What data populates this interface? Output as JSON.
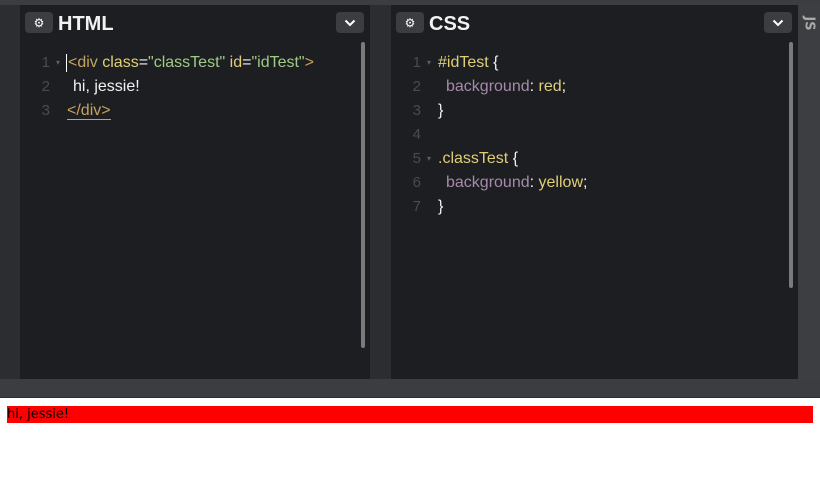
{
  "html_panel": {
    "title": "HTML",
    "gear_icon": "gear-icon",
    "chevron_icon": "chevron-down-icon",
    "line_numbers": [
      "1",
      "2",
      "3"
    ],
    "lines": [
      {
        "open": "<div",
        "attr1": "class",
        "eq1": "=",
        "val1": "\"classTest\"",
        "attr2": "id",
        "eq2": "=",
        "val2": "\"idTest\"",
        "close": ">"
      },
      {
        "text": "hi, jessie!"
      },
      {
        "tag": "</div>"
      }
    ]
  },
  "css_panel": {
    "title": "CSS",
    "gear_icon": "gear-icon",
    "chevron_icon": "chevron-down-icon",
    "line_numbers": [
      "1",
      "2",
      "3",
      "4",
      "5",
      "6",
      "7"
    ],
    "rules": [
      {
        "selector": "#idTest",
        "open": "{",
        "property": "background",
        "colon": ":",
        "value": "red",
        "semi": ";",
        "close": "}"
      },
      {
        "selector": ".classTest",
        "open": "{",
        "property": "background",
        "colon": ":",
        "value": "yellow",
        "semi": ";",
        "close": "}"
      }
    ]
  },
  "js_panel": {
    "label": "JS"
  },
  "preview": {
    "output_text": "hi, jessie!",
    "background_color": "#ff0000"
  },
  "colors": {
    "editor_bg": "#1d1e22",
    "tag": "#c5a25f",
    "attribute": "#dfcf77",
    "string": "#9fcb86",
    "property": "#a58ba8"
  }
}
